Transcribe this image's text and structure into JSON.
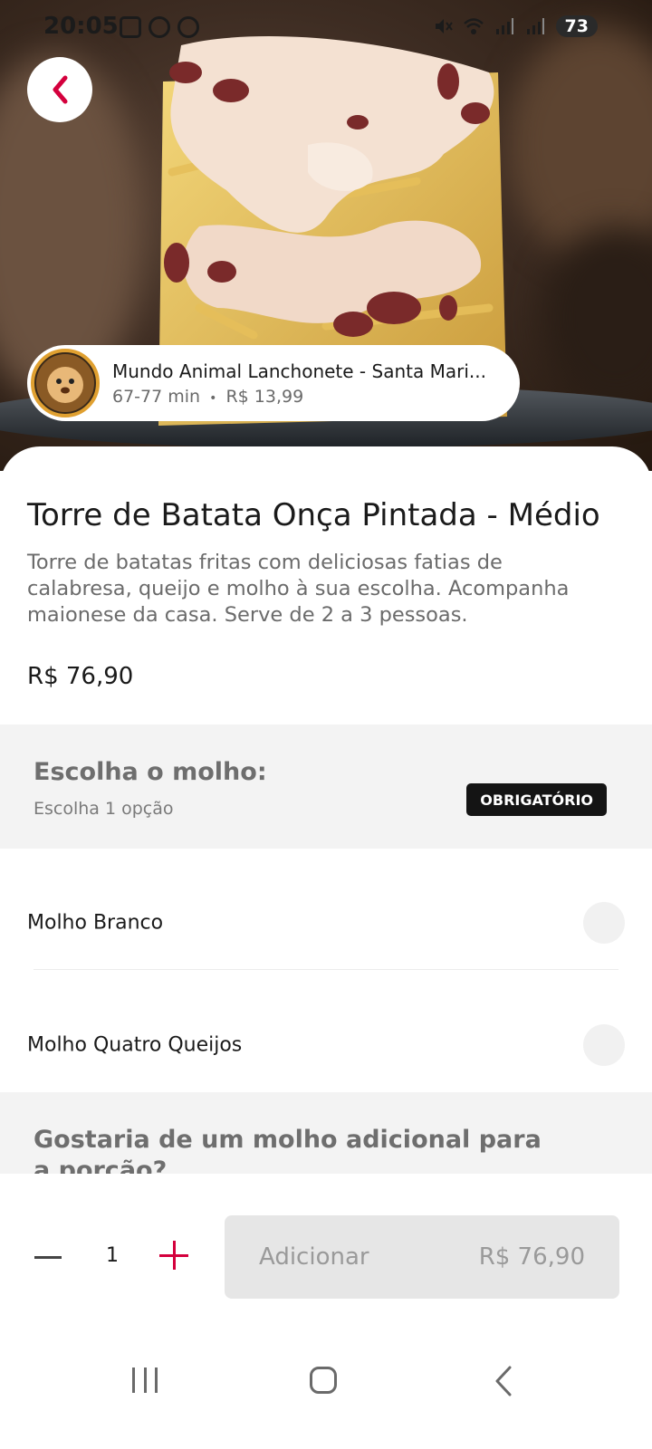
{
  "status_bar": {
    "time": "20:05",
    "battery": "73",
    "icons": [
      "screenshot-icon",
      "whatsapp-icon",
      "globe-icon",
      "mute-icon",
      "wifi-icon",
      "signal-icon",
      "signal-icon"
    ]
  },
  "store": {
    "name": "Mundo Animal Lanchonete - Santa Mari...",
    "delivery_time": "67-77 min",
    "separator": "•",
    "delivery_fee": "R$ 13,99"
  },
  "product": {
    "title": "Torre de Batata Onça Pintada - Médio",
    "description": "Torre de batatas fritas com deliciosas fatias de calabresa, queijo e molho à sua escolha. Acompanha maionese da casa. Serve de 2 a 3 pessoas.",
    "price": "R$ 76,90"
  },
  "option_groups": [
    {
      "title": "Escolha o molho:",
      "subtitle": "Escolha 1 opção",
      "badge": "OBRIGATÓRIO",
      "options": [
        {
          "label": "Molho Branco",
          "selected": false
        },
        {
          "label": "Molho Quatro Queijos",
          "selected": false
        }
      ]
    },
    {
      "title": "Gostaria de um molho adicional para a porção?"
    }
  ],
  "cart": {
    "quantity": "1",
    "add_label": "Adicionar",
    "total": "R$ 76,90"
  },
  "colors": {
    "accent": "#d4003d",
    "badge_bg": "#141414",
    "section_bg": "#f3f3f3",
    "button_disabled_bg": "#e6e6e6"
  }
}
